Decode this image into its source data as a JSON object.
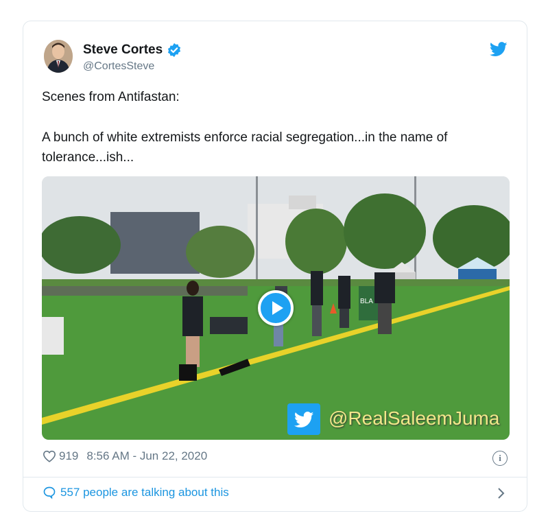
{
  "author": {
    "name": "Steve Cortes",
    "handle": "@CortesSteve"
  },
  "tweet": {
    "line1": "Scenes from Antifastan:",
    "line2": "A bunch of white extremists enforce racial segregation...in the name of tolerance...ish..."
  },
  "media": {
    "watermark": "@RealSaleemJuma",
    "sign_text": "BLA"
  },
  "footer": {
    "likes": "919",
    "timestamp": "8:56 AM - Jun 22, 2020",
    "talking": "557 people are talking about this"
  },
  "colors": {
    "accent": "#1da1f2",
    "link": "#1b95e0",
    "muted": "#657786",
    "grass": "#4f9a3c",
    "field_line": "#e8d22a"
  },
  "icons": [
    "verified-badge-icon",
    "twitter-bird-icon",
    "heart-icon",
    "info-icon",
    "comment-bubble-icon",
    "chevron-right-icon",
    "play-icon"
  ]
}
